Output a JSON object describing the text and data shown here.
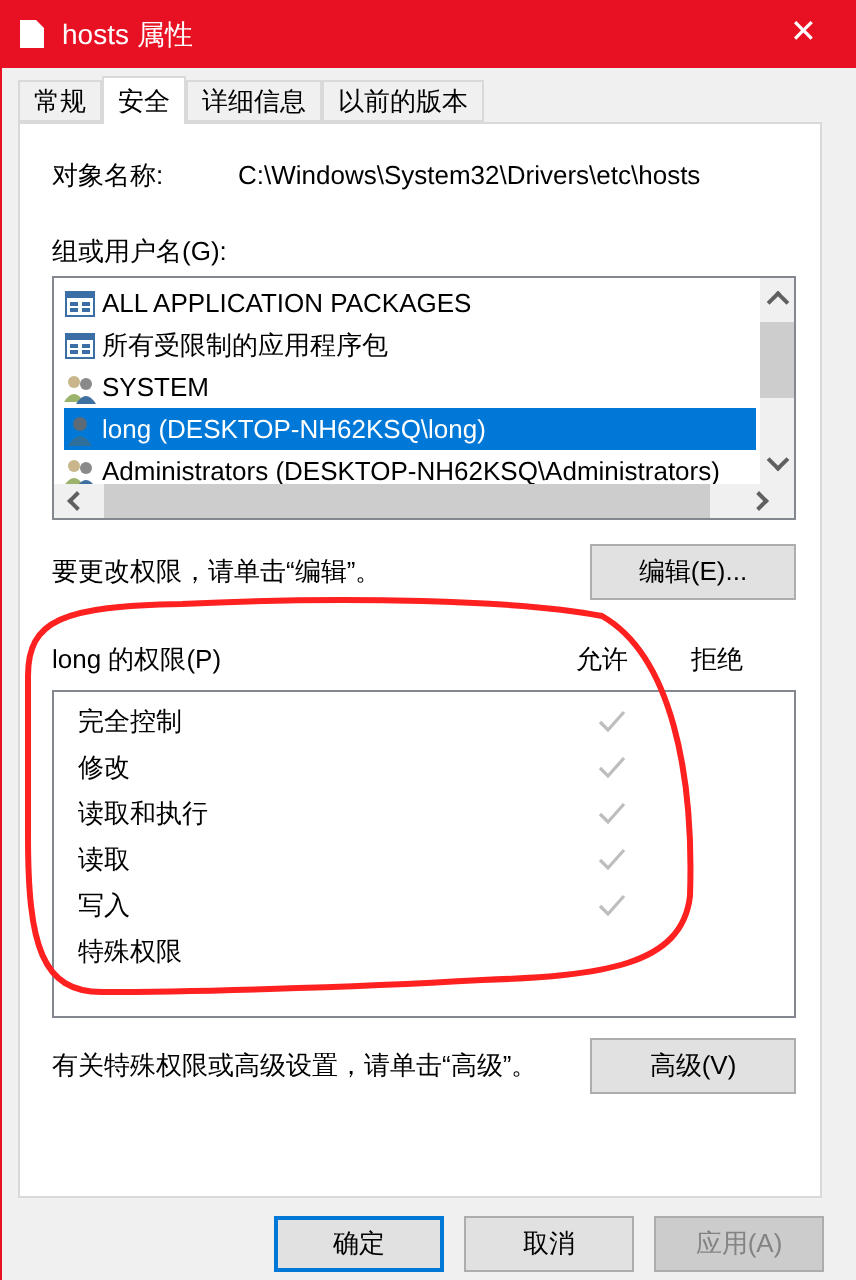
{
  "window": {
    "title": "hosts 属性",
    "close": "✕"
  },
  "tabs": [
    {
      "label": "常规",
      "selected": false
    },
    {
      "label": "安全",
      "selected": true
    },
    {
      "label": "详细信息",
      "selected": false
    },
    {
      "label": "以前的版本",
      "selected": false
    }
  ],
  "object_name": {
    "label": "对象名称:",
    "value": "C:\\Windows\\System32\\Drivers\\etc\\hosts"
  },
  "groups": {
    "label": "组或用户名(G):",
    "items": [
      {
        "kind": "package",
        "name": "ALL APPLICATION PACKAGES",
        "selected": false
      },
      {
        "kind": "package",
        "name": "所有受限制的应用程序包",
        "selected": false
      },
      {
        "kind": "group",
        "name": "SYSTEM",
        "selected": false
      },
      {
        "kind": "user",
        "name": "long (DESKTOP-NH62KSQ\\long)",
        "selected": true
      },
      {
        "kind": "group",
        "name": "Administrators (DESKTOP-NH62KSQ\\Administrators)",
        "selected": false
      }
    ]
  },
  "edit_hint": "要更改权限，请单击“编辑”。",
  "edit_button": "编辑(E)...",
  "permissions": {
    "label": "long 的权限(P)",
    "allow_header": "允许",
    "deny_header": "拒绝",
    "rows": [
      {
        "name": "完全控制",
        "allow": true,
        "deny": false
      },
      {
        "name": "修改",
        "allow": true,
        "deny": false
      },
      {
        "name": "读取和执行",
        "allow": true,
        "deny": false
      },
      {
        "name": "读取",
        "allow": true,
        "deny": false
      },
      {
        "name": "写入",
        "allow": true,
        "deny": false
      },
      {
        "name": "特殊权限",
        "allow": false,
        "deny": false
      }
    ]
  },
  "advanced_hint": "有关特殊权限或高级设置，请单击“高级”。",
  "advanced_button": "高级(V)",
  "buttons": [
    {
      "label": "确定",
      "default": true,
      "disabled": false
    },
    {
      "label": "取消",
      "default": false,
      "disabled": false
    },
    {
      "label": "应用(A)",
      "default": false,
      "disabled": true
    }
  ]
}
